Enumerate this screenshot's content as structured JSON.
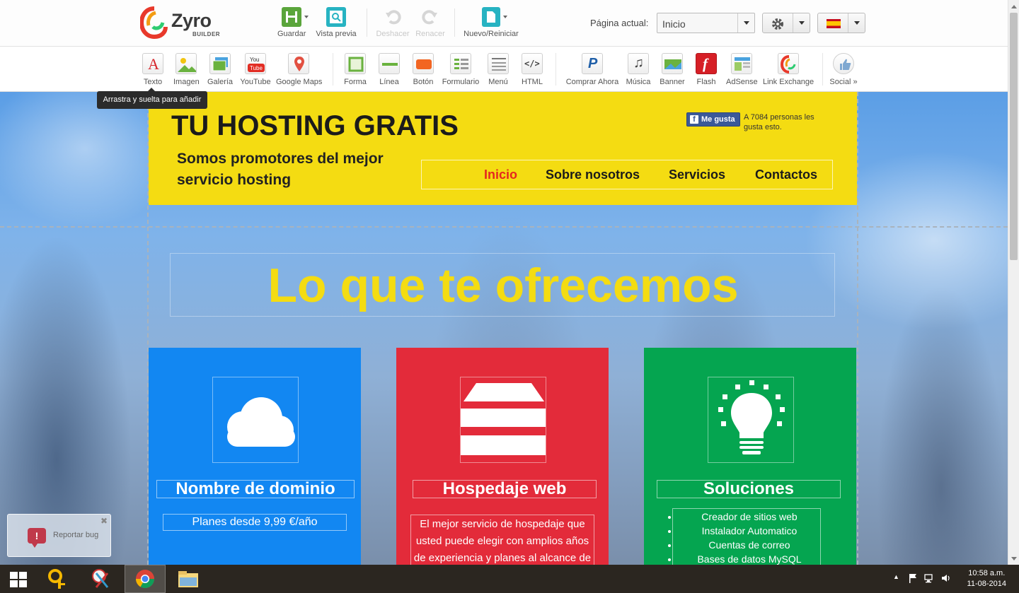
{
  "app": {
    "logo_word": "Zyro",
    "logo_sub": "BUILDER"
  },
  "toolbar": {
    "save_label": "Guardar",
    "preview_label": "Vista previa",
    "undo_label": "Deshacer",
    "redo_label": "Renacer",
    "new_label": "Nuevo/Reiniciar",
    "current_page_label": "Página actual:",
    "current_page_value": "Inicio"
  },
  "elements": [
    {
      "label": "Texto"
    },
    {
      "label": "Imagen"
    },
    {
      "label": "Galería"
    },
    {
      "label": "YouTube"
    },
    {
      "label": "Google Maps"
    },
    {
      "label": "Forma"
    },
    {
      "label": "Línea"
    },
    {
      "label": "Botón"
    },
    {
      "label": "Formulario"
    },
    {
      "label": "Menú"
    },
    {
      "label": "HTML"
    },
    {
      "label": "Comprar Ahora"
    },
    {
      "label": "Música"
    },
    {
      "label": "Banner"
    },
    {
      "label": "Flash"
    },
    {
      "label": "AdSense"
    },
    {
      "label": "Link Exchange"
    },
    {
      "label": "Social »"
    }
  ],
  "tooltip": "Arrastra y suelta para añadir",
  "site": {
    "title": "TU HOSTING GRATIS",
    "tagline": "Somos promotores del mejor servicio hosting",
    "fb_like": "Me gusta",
    "fb_count_text": "A 7084 personas les gusta esto.",
    "nav": [
      "Inicio",
      "Sobre nosotros",
      "Servicios",
      "Contactos"
    ],
    "offer_title": "Lo que te ofrecemos",
    "cards": [
      {
        "heading": "Nombre de dominio",
        "text": "Planes desde 9,99 €/año"
      },
      {
        "heading": "Hospedaje web",
        "text": "El mejor servicio de hospedaje que usted puede elegir con amplios años de experiencia y planes al alcance de"
      },
      {
        "heading": "Soluciones",
        "list": [
          "Creador de sitios web",
          "Instalador Automatico",
          "Cuentas de correo",
          "Bases de datos MySQL"
        ]
      }
    ]
  },
  "bug_report": "Reportar bug",
  "taskbar": {
    "time": "10:58 a.m.",
    "date": "11-08-2014"
  },
  "colors": {
    "header_yellow": "#f4dc12",
    "nav_active": "#e5261f",
    "card_blue": "#1287f2",
    "card_red": "#e32b3a",
    "card_green": "#05a550"
  }
}
